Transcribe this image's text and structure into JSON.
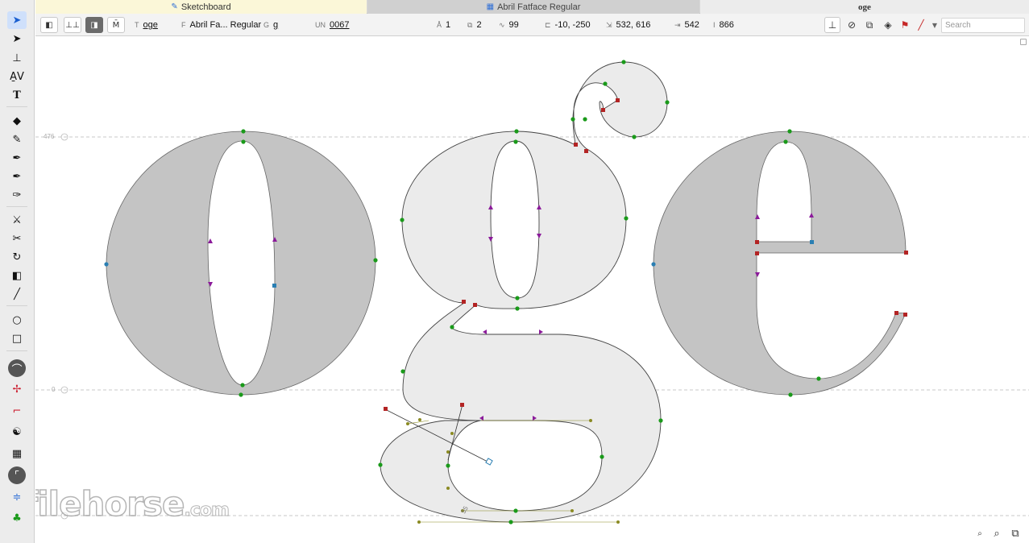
{
  "tabs": [
    {
      "label": "Sketchboard",
      "icon": "pen-icon"
    },
    {
      "label": "Abril Fatface Regular",
      "icon": "grid-icon"
    },
    {
      "label": "oge"
    }
  ],
  "close_glyph": "×",
  "infobar": {
    "text_label": "T",
    "text_value": "oge",
    "font_label": "F",
    "font_value": "Abril Fa... Regular",
    "glyph_label": "G",
    "glyph_value": "g",
    "unicode_label": "UN",
    "unicode_value": "0067",
    "layers_icon": "Å",
    "layers_value": "1",
    "contours_value": "2",
    "nodes_value": "99",
    "origin_value": "-10, -250",
    "size_value": "532, 616",
    "width_value": "542",
    "height_value": "866"
  },
  "search": {
    "placeholder": "Search"
  },
  "metrics": {
    "ascender": "476",
    "baseline": "0"
  },
  "measure_label": "55",
  "watermark": {
    "main": "filehorse",
    "suffix": ".com"
  },
  "colors": {
    "node_green": "#1a9a1a",
    "node_red": "#b32424",
    "node_purple": "#8b1a9a",
    "node_blue": "#2a7fb3",
    "node_olive": "#8a8a22",
    "glyph_fill": "#c4c4c4",
    "glyph_fill_active": "#ebebeb",
    "accent": "#1a5fd0"
  }
}
